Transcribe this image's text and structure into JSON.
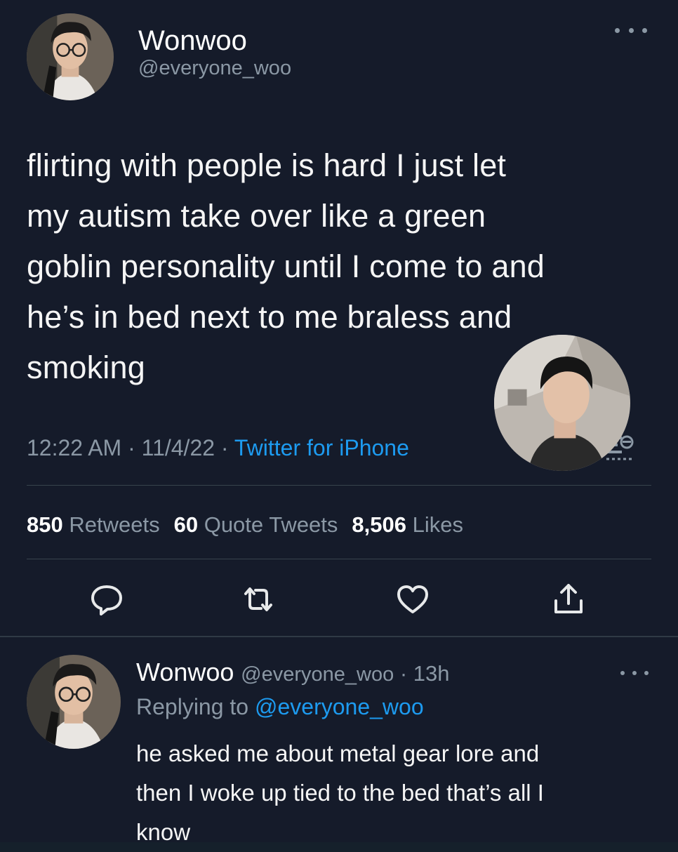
{
  "tweet": {
    "author": {
      "display_name": "Wonwoo",
      "handle": "@everyone_woo",
      "avatar": "profile-photo"
    },
    "more_icon": "more-horizontal-icon",
    "text": "flirting with people is hard I just let\nmy autism take over like a green\ngoblin personality until I come to and\n  he’s in bed next to me braless and\nsmoking",
    "time": "12:22 AM",
    "separator": " · ",
    "date": "11/4/22",
    "client": "Twitter for iPhone",
    "stats": {
      "retweets_count": "850",
      "retweets_label": "Retweets",
      "quotes_count": "60",
      "quotes_label": "Quote Tweets",
      "likes_count": "8,506",
      "likes_label": "Likes"
    },
    "actions": [
      "reply-icon",
      "retweet-icon",
      "like-icon",
      "share-icon"
    ]
  },
  "reply": {
    "display_name": "Wonwoo",
    "handle": "@everyone_woo",
    "time_separator": " · ",
    "time": "13h",
    "replying_label": "Replying to ",
    "replying_to": "@everyone_woo",
    "text": " he asked me about metal gear lore and\nthen I woke up tied to the bed that’s all I\nknow"
  },
  "colors": {
    "background": "#151b2a",
    "text_primary": "#f5f5f5",
    "text_secondary": "#8b98a5",
    "accent": "#1d9bf0",
    "divider": "#38444d"
  }
}
